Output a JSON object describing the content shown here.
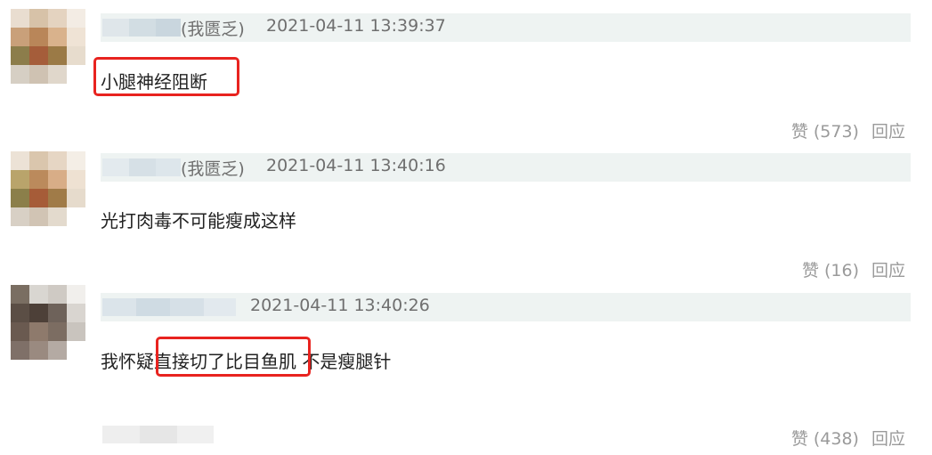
{
  "comments": [
    {
      "tag": "(我匮乏)",
      "time": "2021-04-11 13:39:37",
      "text": "小腿神经阻断",
      "like_label": "赞 (573)",
      "reply_label": "回应"
    },
    {
      "tag": "(我匮乏)",
      "time": "2021-04-11 13:40:16",
      "text": "光打肉毒不可能瘦成这样",
      "like_label": "赞 (16)",
      "reply_label": "回应"
    },
    {
      "tag": "",
      "time": "2021-04-11 13:40:26",
      "text_before": "我怀疑",
      "text_highlight": "直接切了比目鱼肌",
      "text_after": " 不是瘦腿针",
      "like_label": "赞 (438)",
      "reply_label": "回应"
    }
  ],
  "colors": {
    "highlight_box": "#e8231f",
    "header_bar": "#eef3f2",
    "meta_text": "#6f6f6f",
    "action_text": "#9a9a9a"
  }
}
